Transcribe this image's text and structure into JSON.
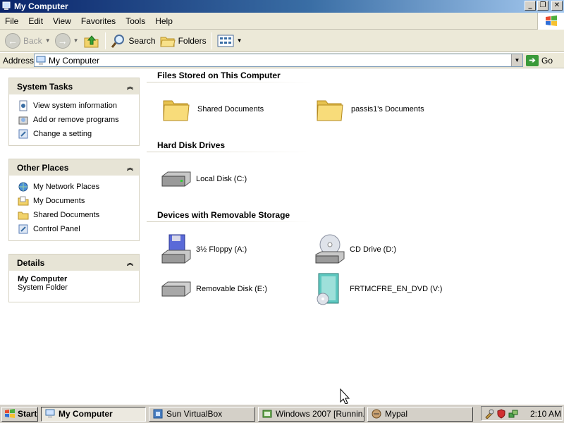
{
  "window": {
    "title": "My Computer"
  },
  "menu": [
    "File",
    "Edit",
    "View",
    "Favorites",
    "Tools",
    "Help"
  ],
  "toolbar": {
    "back": "Back",
    "search": "Search",
    "folders": "Folders"
  },
  "address": {
    "label": "Address",
    "value": "My Computer",
    "go": "Go"
  },
  "left": {
    "system_tasks": {
      "title": "System Tasks",
      "items": [
        "View system information",
        "Add or remove programs",
        "Change a setting"
      ]
    },
    "other_places": {
      "title": "Other Places",
      "items": [
        "My Network Places",
        "My Documents",
        "Shared Documents",
        "Control Panel"
      ]
    },
    "details": {
      "title": "Details",
      "name": "My Computer",
      "type": "System Folder"
    }
  },
  "groups": {
    "files": {
      "title": "Files Stored on This Computer",
      "items": [
        "Shared Documents",
        "passis1's Documents"
      ]
    },
    "hdd": {
      "title": "Hard Disk Drives",
      "items": [
        "Local Disk (C:)"
      ]
    },
    "removable": {
      "title": "Devices with Removable Storage",
      "items": [
        "3½ Floppy (A:)",
        "CD Drive (D:)",
        "Removable Disk (E:)",
        "FRTMCFRE_EN_DVD (V:)"
      ]
    }
  },
  "taskbar": {
    "start": "Start",
    "tasks": [
      "My Computer",
      "Sun VirtualBox",
      "Windows 2007 [Runnin...",
      "Mypal"
    ],
    "clock": "2:10 AM"
  },
  "colors": {
    "titlebar": "#0a246a",
    "panel_header": "#e7e4d6",
    "chrome": "#ece9d8"
  }
}
